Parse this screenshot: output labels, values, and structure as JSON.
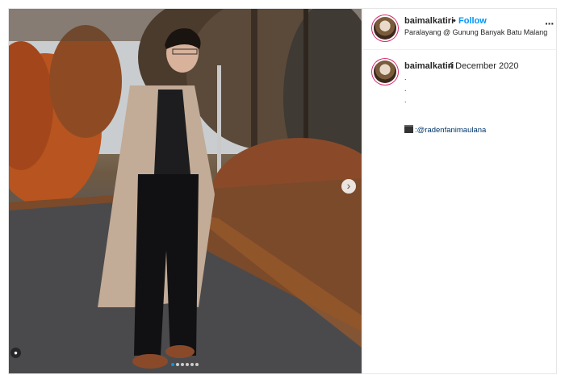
{
  "header": {
    "username": "baimalkatiri",
    "dot": "•",
    "follow_label": "Follow",
    "location": "Paralayang @ Gunung Banyak Batu Malang",
    "more_icon": "more-icon"
  },
  "caption": {
    "username": "baimalkatiri",
    "date": "4 December 2020",
    "dots": [
      ".",
      ".",
      "."
    ],
    "credit": ":@radenfanimaulana",
    "credit_icon": "clapperboard-icon"
  },
  "carousel": {
    "next_icon": "chevron-right-icon",
    "slides": 6,
    "active": 1
  },
  "colors": {
    "follow": "#0095f6",
    "link": "#00376b",
    "avatar_ring": "#d9276f"
  }
}
